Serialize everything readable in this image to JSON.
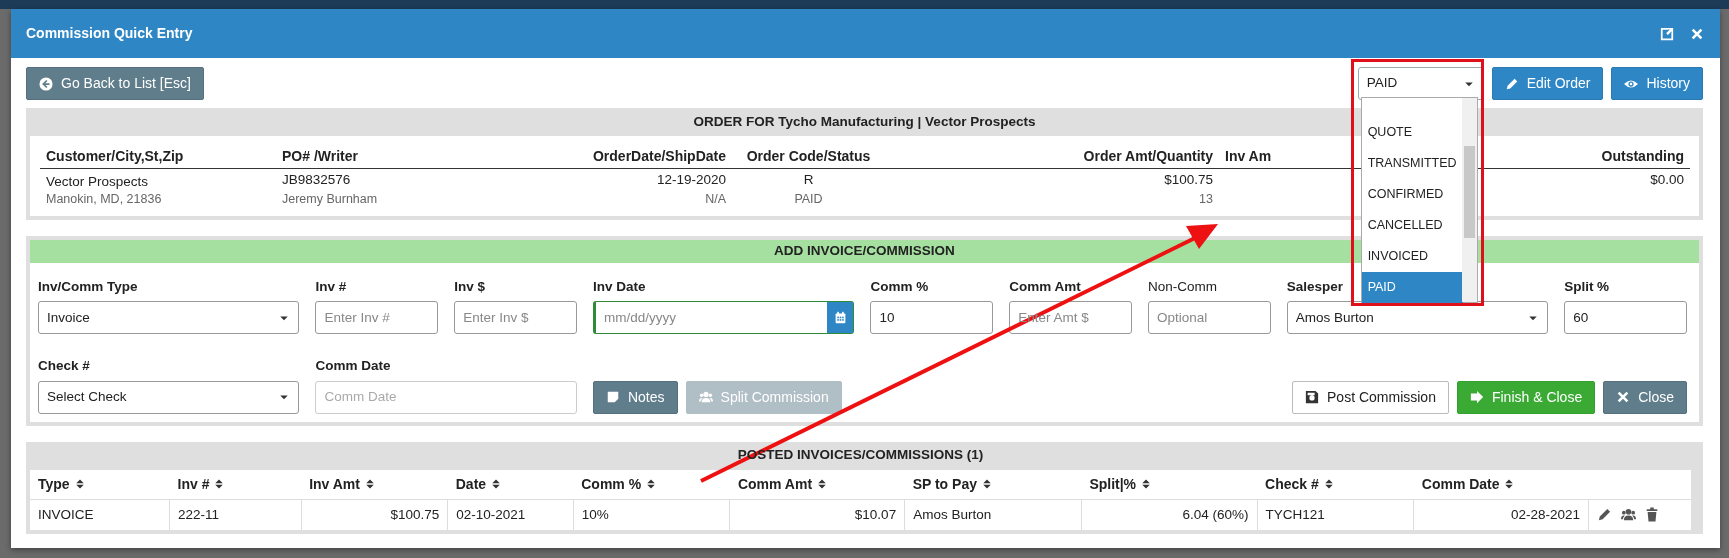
{
  "dialog": {
    "title": "Commission Quick Entry"
  },
  "toolbar": {
    "back_button": "Go Back to List [Esc]",
    "status_select": {
      "value": "PAID",
      "expanded": true,
      "options": [
        {
          "label": "QUOTE",
          "selected": false
        },
        {
          "label": "TRANSMITTED",
          "selected": false
        },
        {
          "label": "CONFIRMED",
          "selected": false
        },
        {
          "label": "CANCELLED",
          "selected": false
        },
        {
          "label": "INVOICED",
          "selected": false
        },
        {
          "label": "PAID",
          "selected": true
        }
      ]
    },
    "buttons": [
      "Edit Order",
      "History"
    ]
  },
  "order": {
    "title": "ORDER FOR Tycho Manufacturing | Vector Prospects",
    "columns": [
      {
        "heading": "Customer/City,St,Zip",
        "kind": "left",
        "line_1": "Vector Prospects",
        "line_2": "Manokin, MD, 21836"
      },
      {
        "heading": "PO# /Writer",
        "kind": "left",
        "line_1": "JB9832576",
        "line_2": "Jeremy Burnham"
      },
      {
        "heading": "OrderDate/ShipDate",
        "kind": "right",
        "line_1": "12-19-2020",
        "line_2": "N/A"
      },
      {
        "heading": "Order Code/Status",
        "kind": "center",
        "line_1": "R",
        "line_2": "PAID"
      },
      {
        "heading": "Order Amt/Quantity",
        "kind": "right",
        "line_1": "$100.75",
        "line_2": "13"
      },
      {
        "heading": "Inv Am",
        "kind": "left"
      },
      {
        "heading": "Outstanding",
        "kind": "right",
        "line_1": "$0.00"
      }
    ]
  },
  "add_invoice": {
    "title": "ADD INVOICE/COMMISSION",
    "fields": [
      {
        "label": "Inv/Comm Type",
        "kind": "select",
        "value": "Invoice",
        "bold": true
      },
      {
        "label": "Inv #",
        "kind": "input",
        "placeholder": "Enter Inv #",
        "bold": true
      },
      {
        "label": "Inv $",
        "kind": "input",
        "placeholder": "Enter Inv $",
        "bold": true
      },
      {
        "label": "Inv Date",
        "kind": "date",
        "placeholder": "mm/dd/yyyy",
        "bold": true,
        "focused": true
      },
      {
        "label": "Comm %",
        "kind": "input",
        "value": "10",
        "bold": true
      },
      {
        "label": "Comm Amt",
        "kind": "input",
        "placeholder": "Enter Amt $",
        "bold": true
      },
      {
        "label": "Non-Comm",
        "kind": "input",
        "placeholder": "Optional",
        "bold": false
      },
      {
        "label": "Salesper",
        "kind": "select",
        "value": "Amos Burton",
        "bold": true
      },
      {
        "label": "Split %",
        "kind": "input",
        "value": "60",
        "bold": true
      }
    ],
    "fields_row_2": [
      {
        "label": "Check #",
        "kind": "select",
        "value": "Select Check",
        "bold": true
      },
      {
        "label": "Comm Date",
        "kind": "input",
        "placeholder": "Comm Date",
        "bold": true,
        "disabled": true
      }
    ],
    "left_buttons": [
      {
        "label": "Notes",
        "kind": "secondary",
        "disabled": false
      },
      {
        "label": "Split Commission",
        "kind": "secondary",
        "disabled": true
      }
    ],
    "right_buttons": [
      {
        "label": "Post Commission",
        "kind": "light"
      },
      {
        "label": "Finish & Close",
        "kind": "success"
      },
      {
        "label": "Close",
        "kind": "secondary"
      }
    ]
  },
  "posted": {
    "title": "POSTED INVOICES/COMMISSIONS (1)",
    "columns": [
      {
        "name": "Type",
        "kind": "left"
      },
      {
        "name": "Inv #",
        "kind": "left"
      },
      {
        "name": "Inv Amt",
        "kind": "right"
      },
      {
        "name": "Date",
        "kind": "left"
      },
      {
        "name": "Comm %",
        "kind": "left"
      },
      {
        "name": "Comm Amt",
        "kind": "right"
      },
      {
        "name": "SP to Pay",
        "kind": "left"
      },
      {
        "name": "Split|%",
        "kind": "right"
      },
      {
        "name": "Check #",
        "kind": "left"
      },
      {
        "name": "Comm Date",
        "kind": "right"
      }
    ],
    "rows": [
      [
        "INVOICE",
        "222-11",
        "$100.75",
        "02-10-2021",
        "10%",
        "$10.07",
        "Amos Burton",
        "6.04 (60%)",
        "TYCH121",
        "02-28-2021"
      ]
    ]
  }
}
